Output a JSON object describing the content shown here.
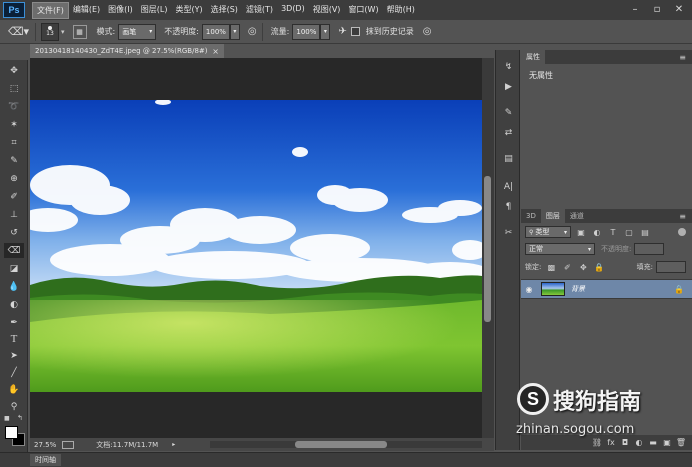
{
  "app": {
    "logo": "Ps"
  },
  "menu": [
    "文件(F)",
    "编辑(E)",
    "图像(I)",
    "图层(L)",
    "类型(Y)",
    "选择(S)",
    "滤镜(T)",
    "3D(D)",
    "视图(V)",
    "窗口(W)",
    "帮助(H)"
  ],
  "options": {
    "brush_size": "13",
    "mode_label": "模式:",
    "mode_value": "画笔",
    "opacity_label": "不透明度:",
    "opacity_value": "100%",
    "flow_label": "流量:",
    "flow_value": "100%",
    "erase_history": "抹到历史记录"
  },
  "document": {
    "tab_title": "20130418140430_ZdT4E.jpeg @ 27.5%(RGB/8#)",
    "close": "×",
    "zoom": "27.5%",
    "doc_size": "文档:11.7M/11.7M"
  },
  "timeline": {
    "label": "时间轴"
  },
  "properties": {
    "tab": "属性",
    "body": "无属性"
  },
  "layers": {
    "tabs": [
      "3D",
      "图层",
      "通道"
    ],
    "filter_label": "类型",
    "blend_mode": "正常",
    "opacity_label": "不透明度:",
    "lock_label": "锁定:",
    "fill_label": "填充:",
    "layer_name": "背景"
  },
  "watermark": {
    "brand": "搜狗指南",
    "url": "zhinan.sogou.com"
  },
  "colors": {
    "accent_layer": "#6e87a8",
    "foreground": "#ffffff",
    "background": "#000000"
  }
}
